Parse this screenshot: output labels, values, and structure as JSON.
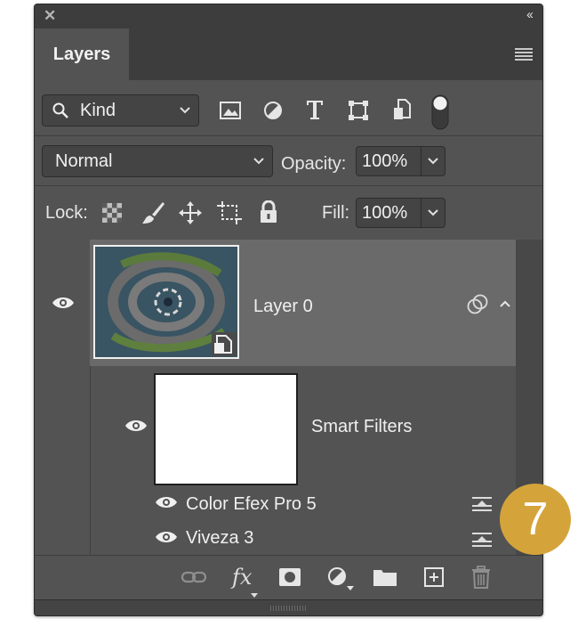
{
  "panel": {
    "tab_label": "Layers",
    "collapse_glyph": "‹‹",
    "close_glyph": "✕"
  },
  "filter_row": {
    "kind_label": "Kind",
    "icons": [
      "image-filter-icon",
      "adjustment-filter-icon",
      "type-filter-icon",
      "shape-filter-icon",
      "smart-object-filter-icon",
      "filter-toggle-icon"
    ]
  },
  "blend_row": {
    "mode_value": "Normal",
    "opacity_label": "Opacity:",
    "opacity_value": "100%"
  },
  "lock_row": {
    "lock_label": "Lock:",
    "fill_label": "Fill:",
    "fill_value": "100%"
  },
  "layers": {
    "layer_name": "Layer 0",
    "smart_filters_label": "Smart Filters",
    "filters": [
      {
        "name": "Color Efex Pro 5"
      },
      {
        "name": "Viveza 3"
      }
    ]
  },
  "bottom_toolbar": {
    "fx_label": "fx",
    "icons": [
      "link-icon",
      "fx-icon",
      "mask-icon",
      "adjustment-icon",
      "folder-icon",
      "new-layer-icon",
      "trash-icon"
    ]
  },
  "badge": {
    "number": "7",
    "color": "#d4a43b"
  }
}
